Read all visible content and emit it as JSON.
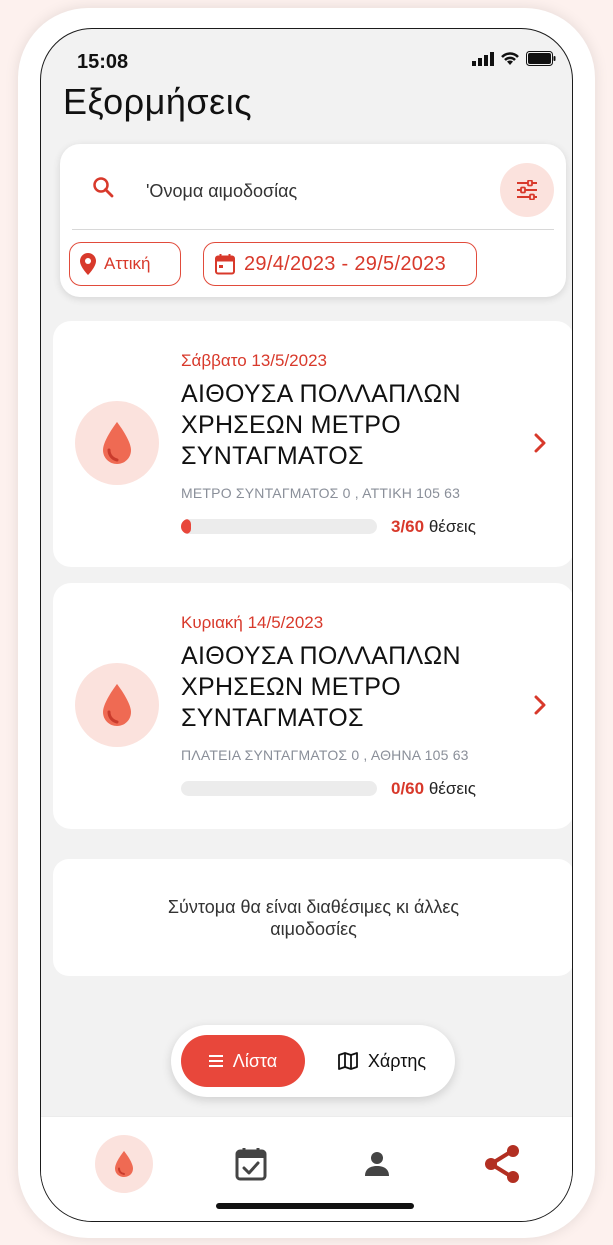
{
  "status_bar": {
    "time": "15:08"
  },
  "header": {
    "title": "Εξορμήσεις"
  },
  "search": {
    "placeholder": "'Ονομα αιμοδοσίας",
    "location_chip": "Αττική",
    "date_range_chip": "29/4/2023 - 29/5/2023"
  },
  "events": [
    {
      "date": "Σάββατο 13/5/2023",
      "title": "ΑΙΘΟΥΣΑ ΠΟΛΛΑΠΛΩΝ ΧΡΗΣΕΩΝ ΜΕΤΡΟ ΣΥΝΤΑΓΜΑΤΟΣ",
      "address": "ΜΕΤΡΟ ΣΥΝΤΑΓΜΑΤΟΣ 0 , ΑΤΤΙΚΗ 105 63",
      "seats_count": "3/60",
      "seats_label": "θέσεις",
      "fill_fraction": 0.05
    },
    {
      "date": "Κυριακή 14/5/2023",
      "title": "ΑΙΘΟΥΣΑ ΠΟΛΛΑΠΛΩΝ ΧΡΗΣΕΩΝ ΜΕΤΡΟ ΣΥΝΤΑΓΜΑΤΟΣ",
      "address": "ΠΛΑΤΕΙΑ ΣΥΝΤΑΓΜΑΤΟΣ 0 , ΑΘΗΝΑ 105 63",
      "seats_count": "0/60",
      "seats_label": "θέσεις",
      "fill_fraction": 0
    }
  ],
  "info": {
    "message": "Σύντομα θα είναι διαθέσιμες κι άλλες αιμοδοσίες"
  },
  "view_toggle": {
    "list_label": "Λίστα",
    "map_label": "Χάρτης",
    "active": "list"
  },
  "bottom_nav": {
    "items": [
      "blood-drop-icon",
      "calendar-check-icon",
      "person-icon",
      "share-icon"
    ],
    "active": "blood-drop-icon"
  },
  "colors": {
    "accent": "#e8473b",
    "accent_text": "#d8392b",
    "soft_accent": "#fbe2dd"
  }
}
